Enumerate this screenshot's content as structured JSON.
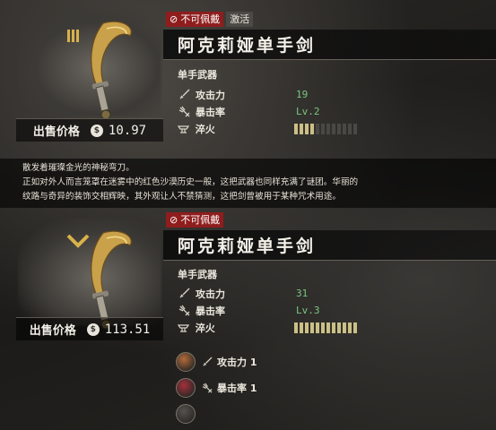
{
  "item1": {
    "badges": {
      "not_wearable": "不可佩戴",
      "activated": "激活"
    },
    "name": "阿克莉娅单手剑",
    "type": "单手武器",
    "price_label": "出售价格",
    "price": "10.97",
    "stats": [
      {
        "label": "攻击力",
        "value": "19",
        "icon": "sword-icon"
      },
      {
        "label": "暴击率",
        "value": "Lv.2",
        "icon": "crit-icon"
      },
      {
        "label": "淬火",
        "value": "",
        "icon": "forge-icon",
        "level": 4,
        "max": 12
      }
    ]
  },
  "description": {
    "line1": "散发着璀璨金光的神秘弯刀。",
    "line2": "正如对外人而言笼罩在迷雾中的红色沙漠历史一般，这把武器也同样充满了谜团。华丽的",
    "line3": "纹路与奇异的装饰交相辉映，其外观让人不禁猜测，这把剑曾被用于某种咒术用途。"
  },
  "item2": {
    "badges": {
      "not_wearable": "不可佩戴"
    },
    "name": "阿克莉娅单手剑",
    "type": "单手武器",
    "price_label": "出售价格",
    "price": "113.51",
    "stats": [
      {
        "label": "攻击力",
        "value": "31",
        "icon": "sword-icon"
      },
      {
        "label": "暴击率",
        "value": "Lv.3",
        "icon": "crit-icon"
      },
      {
        "label": "淬火",
        "value": "",
        "icon": "forge-icon",
        "level": 12,
        "max": 12
      }
    ],
    "gems": [
      {
        "label": "攻击力 1",
        "icon": "sword-icon",
        "color": "#b46a3a"
      },
      {
        "label": "暴击率 1",
        "icon": "crit-icon",
        "color": "#a3303a"
      },
      {
        "label": "",
        "icon": "empty-socket-icon",
        "color": "#555350"
      }
    ]
  },
  "colors": {
    "badge_red": "#8f1d1d",
    "stat_green": "#79c77d",
    "gold": "#d8b24a"
  }
}
